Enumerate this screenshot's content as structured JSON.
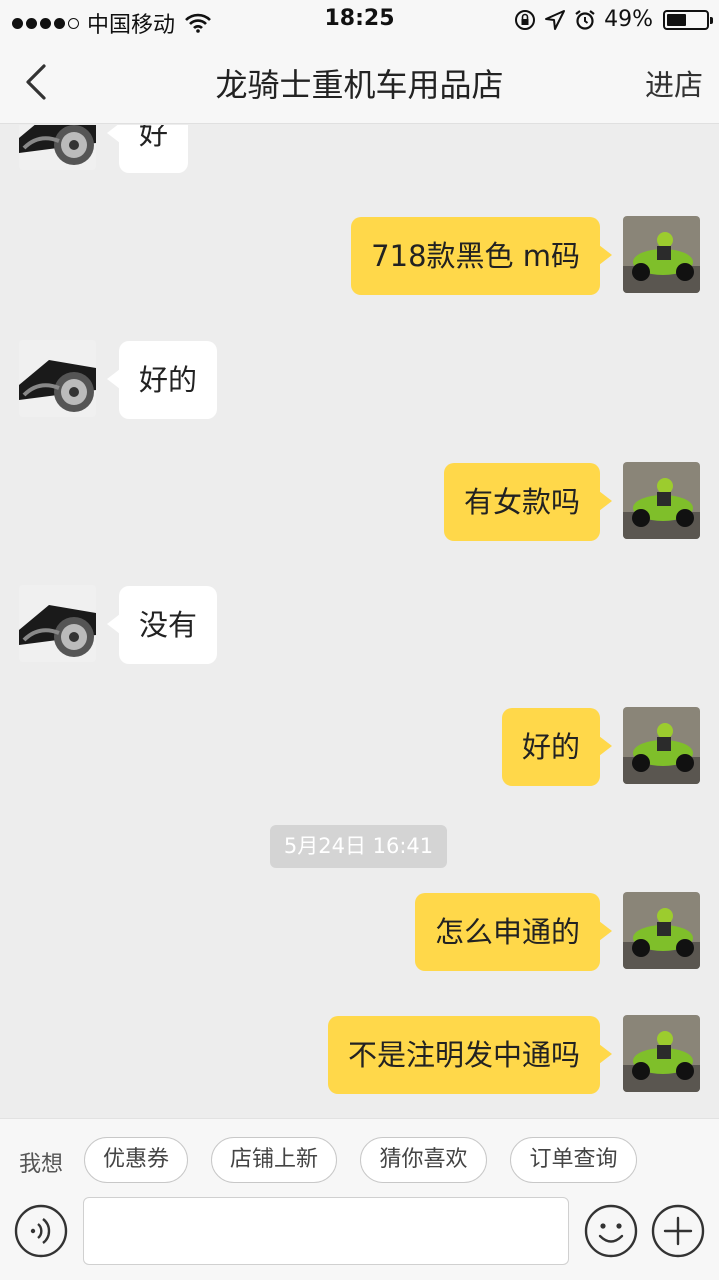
{
  "status_bar": {
    "carrier": "中国移动",
    "time": "18:25",
    "battery_text": "49%",
    "battery_level": 0.49,
    "icons": [
      "signal-dots-icon",
      "wifi-icon",
      "rotation-lock-icon",
      "location-arrow-icon",
      "alarm-icon",
      "battery-icon"
    ]
  },
  "nav": {
    "back_icon": "chevron-left-icon",
    "title": "龙骑士重机车用品店",
    "enter_label": "进店"
  },
  "messages": [
    {
      "from": "shop",
      "text": "好"
    },
    {
      "from": "me",
      "text": "718款黑色 m码"
    },
    {
      "from": "shop",
      "text": "好的"
    },
    {
      "from": "me",
      "text": "有女款吗"
    },
    {
      "from": "shop",
      "text": "没有"
    },
    {
      "from": "me",
      "text": "好的"
    },
    {
      "from": "me",
      "text": "怎么申通的"
    },
    {
      "from": "me",
      "text": "不是注明发中通吗"
    }
  ],
  "timestamp": "5月24日 16:41",
  "quick_bar": {
    "label": "我想",
    "chips": [
      "优惠券",
      "店铺上新",
      "猜你喜欢",
      "订单查询"
    ]
  },
  "input_bar": {
    "voice_icon": "voice-icon",
    "text_value": "",
    "emoji_icon": "emoji-icon",
    "plus_icon": "plus-icon"
  },
  "colors": {
    "my_bubble": "#ffd84a",
    "shop_bubble": "#ffffff",
    "chat_background": "#ededed"
  }
}
